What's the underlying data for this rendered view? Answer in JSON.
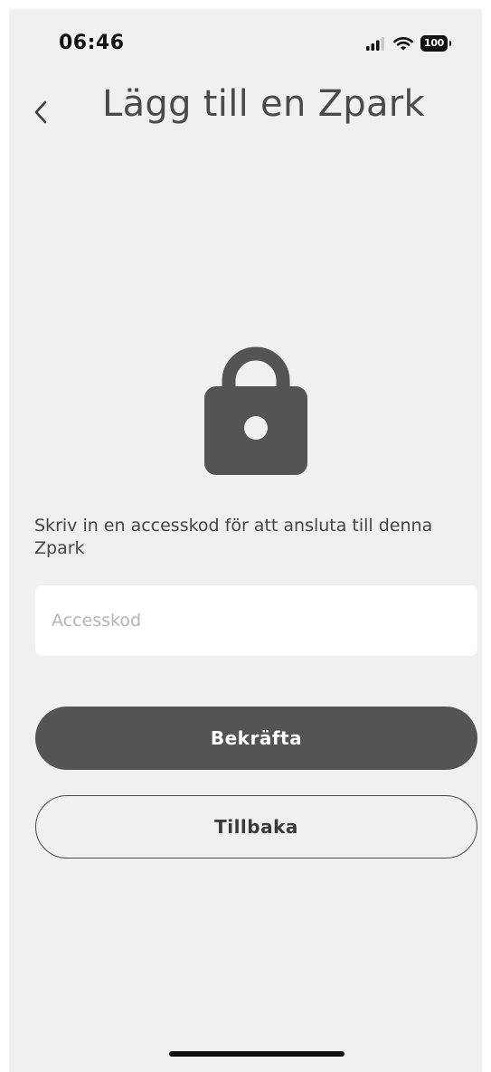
{
  "status_bar": {
    "time": "06:46",
    "battery": "100",
    "icons": [
      "signal-icon",
      "wifi-icon",
      "battery-icon"
    ]
  },
  "header": {
    "back_icon": "chevron-left-icon",
    "title": "Lägg till en Zpark"
  },
  "main": {
    "icon": "lock-icon",
    "description": "Skriv in en accesskod för att ansluta till denna Zpark",
    "access_code": {
      "value": "",
      "placeholder": "Accesskod"
    },
    "confirm_label": "Bekräfta",
    "back_label": "Tillbaka"
  },
  "colors": {
    "background": "#f0f0f0",
    "primary_button": "#545454",
    "text": "#444444"
  }
}
